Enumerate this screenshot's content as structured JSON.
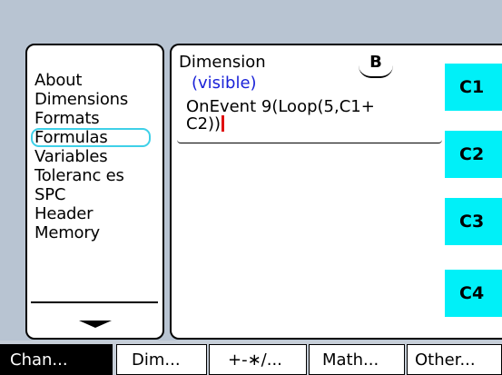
{
  "menu": {
    "items": [
      "About",
      "Dimensions",
      "Formats",
      "Formulas",
      "Variables",
      "Toleranc es",
      "SPC",
      "Header",
      "Memory"
    ],
    "selected": "Formulas",
    "scroll_icon": "down-arrow-icon"
  },
  "editor": {
    "header": "Dimension",
    "letter": "B",
    "visibility": "(visible)",
    "formula_line1": "OnEvent 9(Loop(5,C1+",
    "formula_line2": "C2))"
  },
  "side_buttons": [
    "C1",
    "C2",
    "C3",
    "C4"
  ],
  "softkeys": [
    "Chan...",
    "Dim...",
    "+-∗/...",
    "Math...",
    "Other..."
  ],
  "colors": {
    "background": "#b8c4d2",
    "accent_cyan": "#00f0f8",
    "selection_outline": "#3fd0e8",
    "visible_text": "#1a22d8",
    "cursor": "#e01010"
  }
}
